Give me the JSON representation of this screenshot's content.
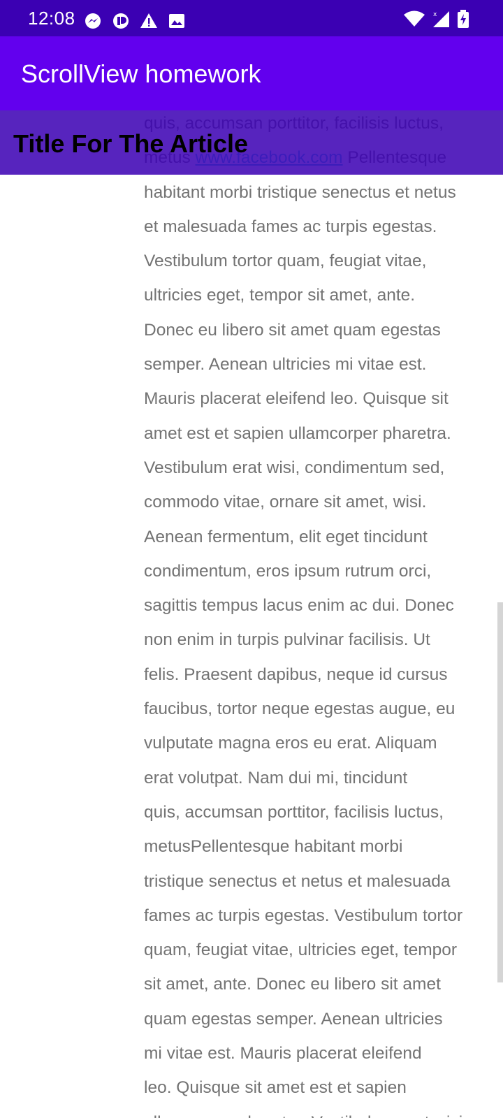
{
  "status_bar": {
    "time": "12:08",
    "left_icons": [
      "messenger-icon",
      "app-notification-icon",
      "warning-icon",
      "image-icon"
    ],
    "right_icons": [
      "wifi-icon",
      "cellular-signal-icon",
      "battery-charging-icon"
    ]
  },
  "app_bar": {
    "title": "ScrollView homework",
    "color": "#6200ee"
  },
  "article": {
    "title": "Title For The Article",
    "lines": [
      {
        "text": "quis, accumsan porttitor, facilisis luctus,"
      },
      {
        "before": "metus ",
        "link": "www.facebook.com",
        "after": " Pellentesque"
      },
      {
        "text": "habitant morbi tristique senectus et netus"
      },
      {
        "text": "et malesuada fames ac turpis egestas."
      },
      {
        "text": "Vestibulum tortor quam, feugiat vitae,"
      },
      {
        "text": "ultricies eget, tempor sit amet, ante."
      },
      {
        "text": "Donec eu libero sit amet quam egestas"
      },
      {
        "text": "semper. Aenean ultricies mi vitae est."
      },
      {
        "text": "Mauris placerat eleifend leo. Quisque sit"
      },
      {
        "text": "amet est et sapien ullamcorper pharetra."
      },
      {
        "text": "Vestibulum erat wisi, condimentum sed,"
      },
      {
        "text": "commodo vitae, ornare sit amet, wisi."
      },
      {
        "text": "Aenean fermentum, elit eget tincidunt"
      },
      {
        "text": "condimentum, eros ipsum rutrum orci,"
      },
      {
        "text": "sagittis tempus lacus enim ac dui. Donec"
      },
      {
        "text": "non enim in turpis pulvinar facilisis. Ut"
      },
      {
        "text": "felis. Praesent dapibus, neque id cursus"
      },
      {
        "text": "faucibus, tortor neque egestas augue, eu"
      },
      {
        "text": "vulputate magna eros eu erat. Aliquam"
      },
      {
        "text": "erat volutpat. Nam dui mi, tincidunt"
      },
      {
        "text": "quis, accumsan porttitor, facilisis luctus,"
      },
      {
        "text": "metusPellentesque habitant morbi"
      },
      {
        "text": "tristique senectus et netus et malesuada"
      },
      {
        "text": "fames ac turpis egestas. Vestibulum tortor"
      },
      {
        "text": "quam, feugiat vitae, ultricies eget, tempor"
      },
      {
        "text": "sit amet, ante. Donec eu libero sit amet"
      },
      {
        "text": "quam egestas semper. Aenean ultricies"
      },
      {
        "text": "mi vitae est. Mauris placerat eleifend"
      },
      {
        "text": "leo. Quisque sit amet est et sapien"
      },
      {
        "text": "ullamcorper pharetra. Vestibulum erat wisi,"
      }
    ],
    "text_color": "#737373",
    "link_color": "#3ec6e4"
  }
}
